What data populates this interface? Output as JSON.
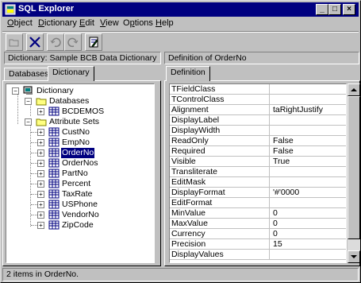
{
  "window": {
    "title": "SQL Explorer"
  },
  "menu": [
    {
      "label": "Object",
      "u": "O"
    },
    {
      "label": "Dictionary",
      "u": "D"
    },
    {
      "label": "Edit",
      "u": "E"
    },
    {
      "label": "View",
      "u": "V"
    },
    {
      "label": "Options",
      "u": "p"
    },
    {
      "label": "Help",
      "u": "H"
    }
  ],
  "left_header": "Dictionary: Sample BCB Data Dictionary",
  "right_header": "Definition of OrderNo",
  "left_tabs": [
    "Databases",
    "Dictionary"
  ],
  "right_tab": "Definition",
  "tree": {
    "root": "Dictionary",
    "databases_label": "Databases",
    "database_item": "BCDEMOS",
    "attr_sets_label": "Attribute Sets",
    "attributes": [
      "CustNo",
      "EmpNo",
      "OrderNo",
      "OrderNos",
      "PartNo",
      "Percent",
      "TaxRate",
      "USPhone",
      "VendorNo",
      "ZipCode"
    ],
    "selected": "OrderNo"
  },
  "properties": [
    {
      "k": "TFieldClass",
      "v": ""
    },
    {
      "k": "TControlClass",
      "v": ""
    },
    {
      "k": "Alignment",
      "v": "taRightJustify"
    },
    {
      "k": "DisplayLabel",
      "v": ""
    },
    {
      "k": "DisplayWidth",
      "v": ""
    },
    {
      "k": "ReadOnly",
      "v": "False"
    },
    {
      "k": "Required",
      "v": "False"
    },
    {
      "k": "Visible",
      "v": "True"
    },
    {
      "k": "Transliterate",
      "v": ""
    },
    {
      "k": "EditMask",
      "v": ""
    },
    {
      "k": "DisplayFormat",
      "v": "'#'0000"
    },
    {
      "k": "EditFormat",
      "v": ""
    },
    {
      "k": "MinValue",
      "v": "0"
    },
    {
      "k": "MaxValue",
      "v": "0"
    },
    {
      "k": "Currency",
      "v": "0"
    },
    {
      "k": "Precision",
      "v": "15"
    },
    {
      "k": "DisplayValues",
      "v": ""
    }
  ],
  "status": "2 items in OrderNo.",
  "colors": {
    "titlebar": "#000080",
    "face": "#c0c0c0",
    "selection": "#000080"
  }
}
